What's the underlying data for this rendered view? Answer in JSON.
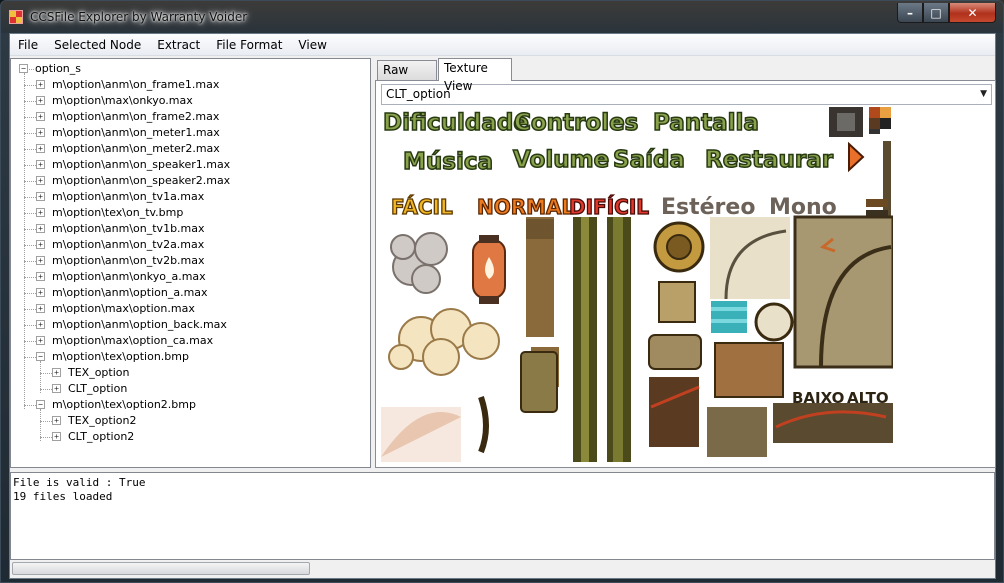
{
  "window": {
    "title": "CCSFile Explorer by Warranty Voider",
    "minimize_glyph": "–",
    "maximize_glyph": "□",
    "close_glyph": "✕"
  },
  "menu": [
    "File",
    "Selected Node",
    "Extract",
    "File Format",
    "View"
  ],
  "tree": {
    "root": "option_s",
    "items": [
      "m\\option\\anm\\on_frame1.max",
      "m\\option\\max\\onkyo.max",
      "m\\option\\anm\\on_frame2.max",
      "m\\option\\anm\\on_meter1.max",
      "m\\option\\anm\\on_meter2.max",
      "m\\option\\anm\\on_speaker1.max",
      "m\\option\\anm\\on_speaker2.max",
      "m\\option\\anm\\on_tv1a.max",
      "m\\option\\tex\\on_tv.bmp",
      "m\\option\\anm\\on_tv1b.max",
      "m\\option\\anm\\on_tv2a.max",
      "m\\option\\anm\\on_tv2b.max",
      "m\\option\\anm\\onkyo_a.max",
      "m\\option\\anm\\option_a.max",
      "m\\option\\max\\option.max",
      "m\\option\\anm\\option_back.max",
      "m\\option\\max\\option_ca.max",
      "m\\option\\tex\\option.bmp",
      "TEX_option",
      "CLT_option",
      "m\\option\\tex\\option2.bmp",
      "TEX_option2",
      "CLT_option2"
    ]
  },
  "tabs": {
    "raw": "Raw View",
    "texture": "Texture View"
  },
  "texture_view": {
    "selected_texture": "CLT_option",
    "words": {
      "dificuldade": "Dificuldade",
      "controles": "Controles",
      "pantalla": "Pantalla",
      "musica": "Música",
      "volume": "Volume",
      "saida": "Saída",
      "restaurar": "Restaurar",
      "facil": "FÁCIL",
      "normal": "NORMAL",
      "dificil": "DIFÍCIL",
      "estereo": "Estéreo",
      "mono": "Mono",
      "baixo": "BAIXO",
      "alto": "ALTO"
    }
  },
  "log": {
    "lines": [
      "File is valid : True",
      "19 files loaded"
    ]
  },
  "colors": {
    "accent_close": "#c6492e",
    "menu_bg": "#f0f0f0",
    "green_word": "#8aa24b",
    "grey_word": "#6d6259"
  }
}
